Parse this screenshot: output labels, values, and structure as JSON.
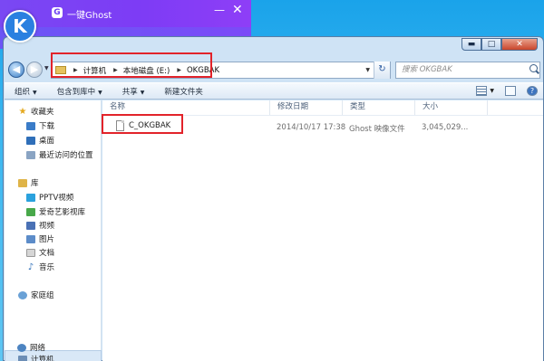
{
  "background_app": {
    "logo": "G",
    "title": "一键Ghost",
    "minimize": "—",
    "close": "✕",
    "badge": "K"
  },
  "window": {
    "caption": {
      "minimize": "▬",
      "maximize": "□",
      "close": "✕"
    }
  },
  "address_bar": {
    "back_glyph": "◀",
    "forward_glyph": "▶",
    "breadcrumbs": [
      "计算机",
      "本地磁盘 (E:)",
      "OKGBAK"
    ],
    "refresh_glyph": "↻"
  },
  "search": {
    "placeholder": "搜索 OKGBAK"
  },
  "toolbar": {
    "organize": "组织",
    "include_in_library": "包含到库中",
    "share": "共享",
    "new_folder": "新建文件夹",
    "help_glyph": "?"
  },
  "nav_pane": {
    "favorites": "收藏夹",
    "downloads": "下载",
    "desktop": "桌面",
    "recent": "最近访问的位置",
    "libraries": "库",
    "pptv": "PPTV视频",
    "iqiyi": "爱奇艺影视库",
    "videos": "视频",
    "pictures": "图片",
    "documents": "文档",
    "music": "音乐",
    "homegroup": "家庭组",
    "computer": "计算机",
    "network": "网络"
  },
  "columns": {
    "name": "名称",
    "modified": "修改日期",
    "type": "类型",
    "size": "大小"
  },
  "files": [
    {
      "name": "C_OKGBAK",
      "modified": "2014/10/17 17:38",
      "type": "Ghost 映像文件",
      "size": "3,045,029..."
    }
  ],
  "colors": {
    "highlight": "#e2232a",
    "ghost_purple": "#7a48f3",
    "desktop_blue": "#1aa3ea"
  }
}
